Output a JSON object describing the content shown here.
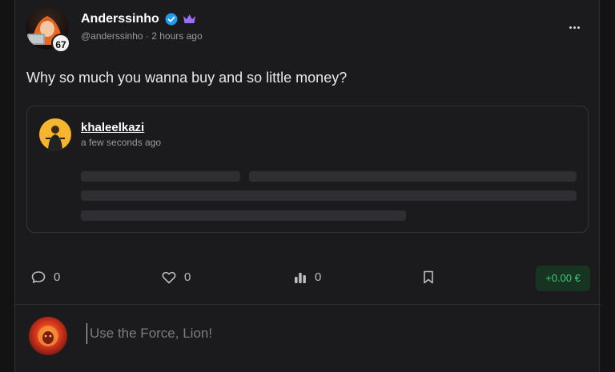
{
  "post": {
    "author": {
      "name": "Anderssinho",
      "handle": "@anderssinho",
      "separator": "·",
      "time": "2 hours ago",
      "level": "67",
      "badges": [
        "verified-icon",
        "crown-icon"
      ]
    },
    "text": "Why so much you wanna buy and so little money?",
    "embed": {
      "author": "khaleelkazi",
      "time": "a few seconds ago"
    },
    "actions": {
      "comments": "0",
      "likes": "0",
      "views": "0",
      "tip": "+0.00 €"
    }
  },
  "composer": {
    "placeholder": "Use the Force, Lion!"
  },
  "colors": {
    "background": "#1b1b1d",
    "verified": "#1d9bf0",
    "crown": "#9b6cff",
    "tip_bg": "#173423",
    "tip_text": "#3ecb78"
  }
}
